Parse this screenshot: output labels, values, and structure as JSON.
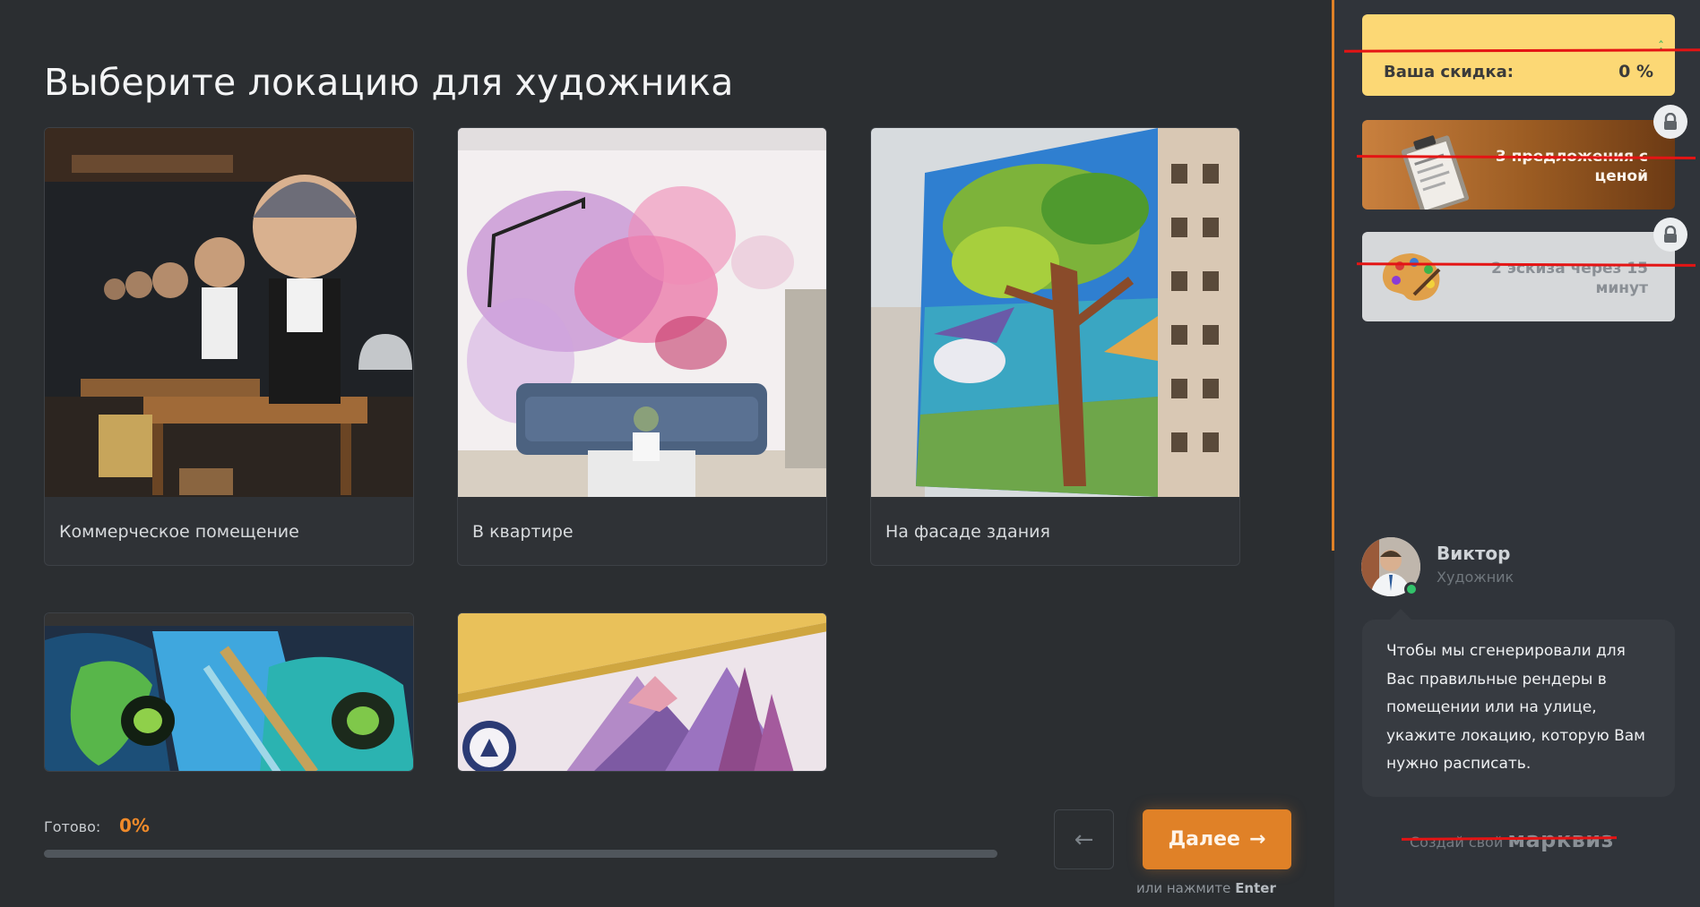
{
  "main": {
    "title": "Выберите локацию для художника",
    "locations": [
      {
        "label": "Коммерческое помещение"
      },
      {
        "label": "В квартире"
      },
      {
        "label": "На фасаде здания"
      },
      {
        "label": ""
      },
      {
        "label": ""
      }
    ],
    "progress": {
      "label": "Готово:",
      "value_text": "0%",
      "fraction": 0
    },
    "nav": {
      "back_icon": "arrow-left-icon",
      "next_label": "Далее",
      "next_icon": "arrow-right-icon",
      "hint_prefix": "или нажмите",
      "hint_key": "Enter"
    }
  },
  "sidebar": {
    "discount": {
      "label": "Ваша скидка:",
      "value": "0 %"
    },
    "offers": [
      {
        "text": "3 предложения с ценой",
        "locked": true
      },
      {
        "text": "2 эскиза через 15 минут",
        "locked": true
      }
    ],
    "agent": {
      "name": "Виктор",
      "role": "Художник",
      "message": "Чтобы мы сгенерировали для Вас правильные рендеры в помещении или на улице, укажите локацию, которую Вам нужно расписать."
    },
    "brand": {
      "prefix": "Создай свой",
      "name": "марквиз"
    }
  },
  "colors": {
    "accent": "#e08127",
    "background": "#2b2e31",
    "discount_bg": "#fcd875",
    "strike": "#e41414",
    "online": "#32c26a"
  }
}
